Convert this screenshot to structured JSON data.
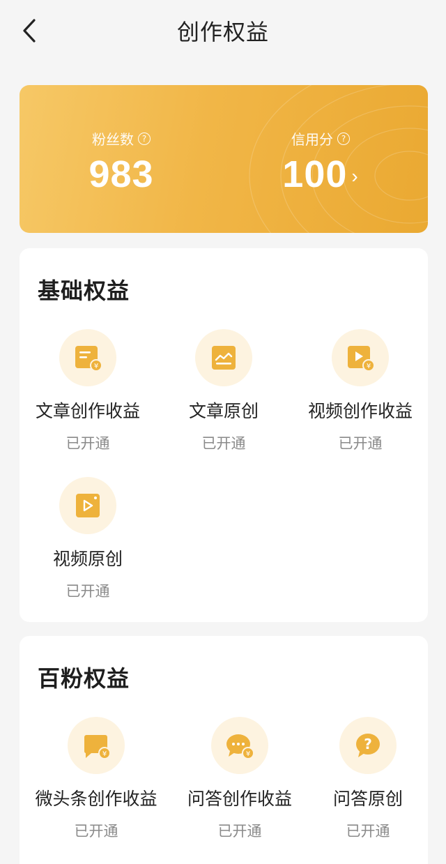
{
  "nav": {
    "title": "创作权益"
  },
  "stats": {
    "fans": {
      "label": "粉丝数",
      "value": "983"
    },
    "credit": {
      "label": "信用分",
      "value": "100"
    },
    "help_glyph": "?",
    "chevron": "›"
  },
  "basic": {
    "title": "基础权益",
    "items": [
      {
        "label": "文章创作收益",
        "status": "已开通",
        "icon": "article-income-icon"
      },
      {
        "label": "文章原创",
        "status": "已开通",
        "icon": "article-original-icon"
      },
      {
        "label": "视频创作收益",
        "status": "已开通",
        "icon": "video-income-icon"
      },
      {
        "label": "视频原创",
        "status": "已开通",
        "icon": "video-original-icon"
      }
    ]
  },
  "hundred": {
    "title": "百粉权益",
    "items": [
      {
        "label": "微头条创作收益",
        "status": "已开通",
        "icon": "micro-post-income-icon"
      },
      {
        "label": "问答创作收益",
        "status": "已开通",
        "icon": "qa-income-icon"
      },
      {
        "label": "问答原创",
        "status": "已开通",
        "icon": "qa-original-icon"
      }
    ]
  },
  "colors": {
    "accent": "#f1b647",
    "icon_bg": "#fdf3e0",
    "icon": "#eeb23c"
  }
}
